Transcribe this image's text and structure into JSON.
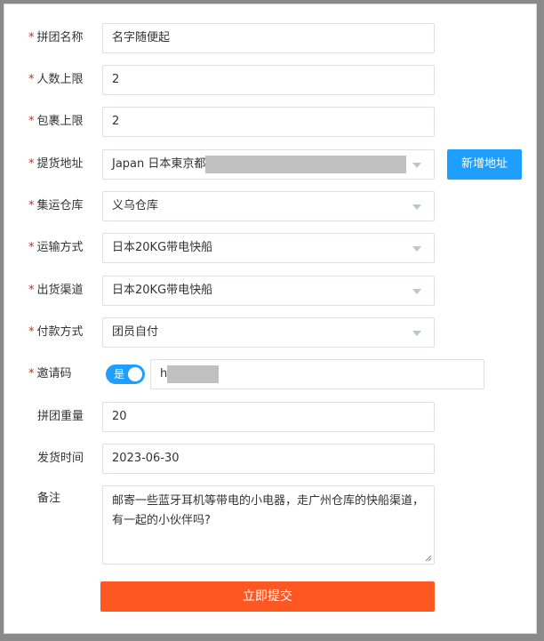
{
  "form": {
    "group_name": {
      "label": "拼团名称",
      "value": "名字随便起"
    },
    "people_limit": {
      "label": "人数上限",
      "value": "2"
    },
    "package_limit": {
      "label": "包裹上限",
      "value": "2"
    },
    "pickup_address": {
      "label": "提货地址",
      "value": "Japan 日本東京都"
    },
    "add_address_label": "新增地址",
    "warehouse": {
      "label": "集运仓库",
      "value": "义乌仓库"
    },
    "shipping_method": {
      "label": "运输方式",
      "value": "日本20KG带电快船"
    },
    "shipping_channel": {
      "label": "出货渠道",
      "value": "日本20KG带电快船"
    },
    "payment_method": {
      "label": "付款方式",
      "value": "团员自付"
    },
    "invite_code": {
      "label": "邀请码",
      "toggle_label": "是",
      "value": "h"
    },
    "group_weight": {
      "label": "拼团重量",
      "value": "20"
    },
    "ship_date": {
      "label": "发货时间",
      "value": "2023-06-30"
    },
    "remark": {
      "label": "备注",
      "value": "邮寄一些蓝牙耳机等带电的小电器，走广州仓库的快船渠道，有一起的小伙伴吗?"
    },
    "submit_label": "立即提交"
  },
  "colors": {
    "required": "#e2231a",
    "primary_blue": "#1e9fff",
    "submit_orange": "#ff5722"
  }
}
